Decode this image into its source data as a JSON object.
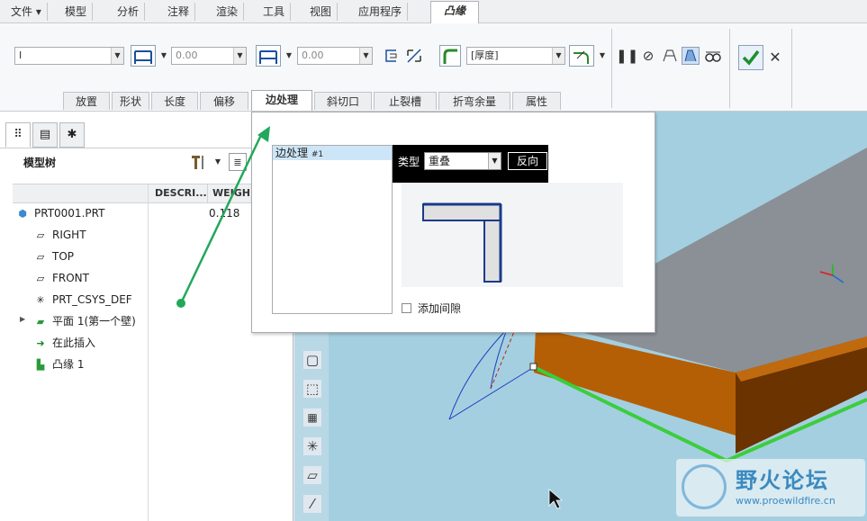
{
  "menubar": {
    "file": "文件",
    "items": [
      "模型",
      "分析",
      "注释",
      "渲染",
      "工具",
      "视图",
      "应用程序"
    ],
    "active_tab": "凸缘"
  },
  "ribbon": {
    "shape_combo": "I",
    "len1_value": "0.00",
    "len2_value": "0.00",
    "thickness_combo": "[厚度]",
    "tabs": [
      "放置",
      "形状",
      "长度",
      "偏移",
      "边处理",
      "斜切口",
      "止裂槽",
      "折弯余量",
      "属性"
    ],
    "active_tab_index": 4
  },
  "left_panel": {
    "tree_title": "模型树",
    "col_desc": "DESCRI...",
    "col_weight": "WEIGH",
    "items": [
      {
        "label": "PRT0001.PRT",
        "icon": "part-icon",
        "weight": "0.118"
      },
      {
        "label": "RIGHT",
        "icon": "datum-plane-icon"
      },
      {
        "label": "TOP",
        "icon": "datum-plane-icon"
      },
      {
        "label": "FRONT",
        "icon": "datum-plane-icon"
      },
      {
        "label": "PRT_CSYS_DEF",
        "icon": "csys-icon"
      },
      {
        "label": "平面 1(第一个壁)",
        "icon": "planar-wall-icon"
      },
      {
        "label": "在此插入",
        "icon": "insert-here-icon"
      },
      {
        "label": "凸缘 1",
        "icon": "flange-icon"
      }
    ]
  },
  "popup": {
    "list_item": "边处理",
    "list_item_id": "#1",
    "type_label": "类型",
    "type_value": "重叠",
    "reverse_button": "反向",
    "add_gap_label": "添加间隙"
  },
  "watermark": {
    "title": "野火论坛",
    "url": "www.proewildfire.cn"
  },
  "colors": {
    "viewport_bg": "#a4cfe0",
    "flange_orange": "#b45f06",
    "top_face_gray": "#8a9096",
    "edge_green": "#3ccd3c",
    "arrow_green": "#22a85a"
  }
}
